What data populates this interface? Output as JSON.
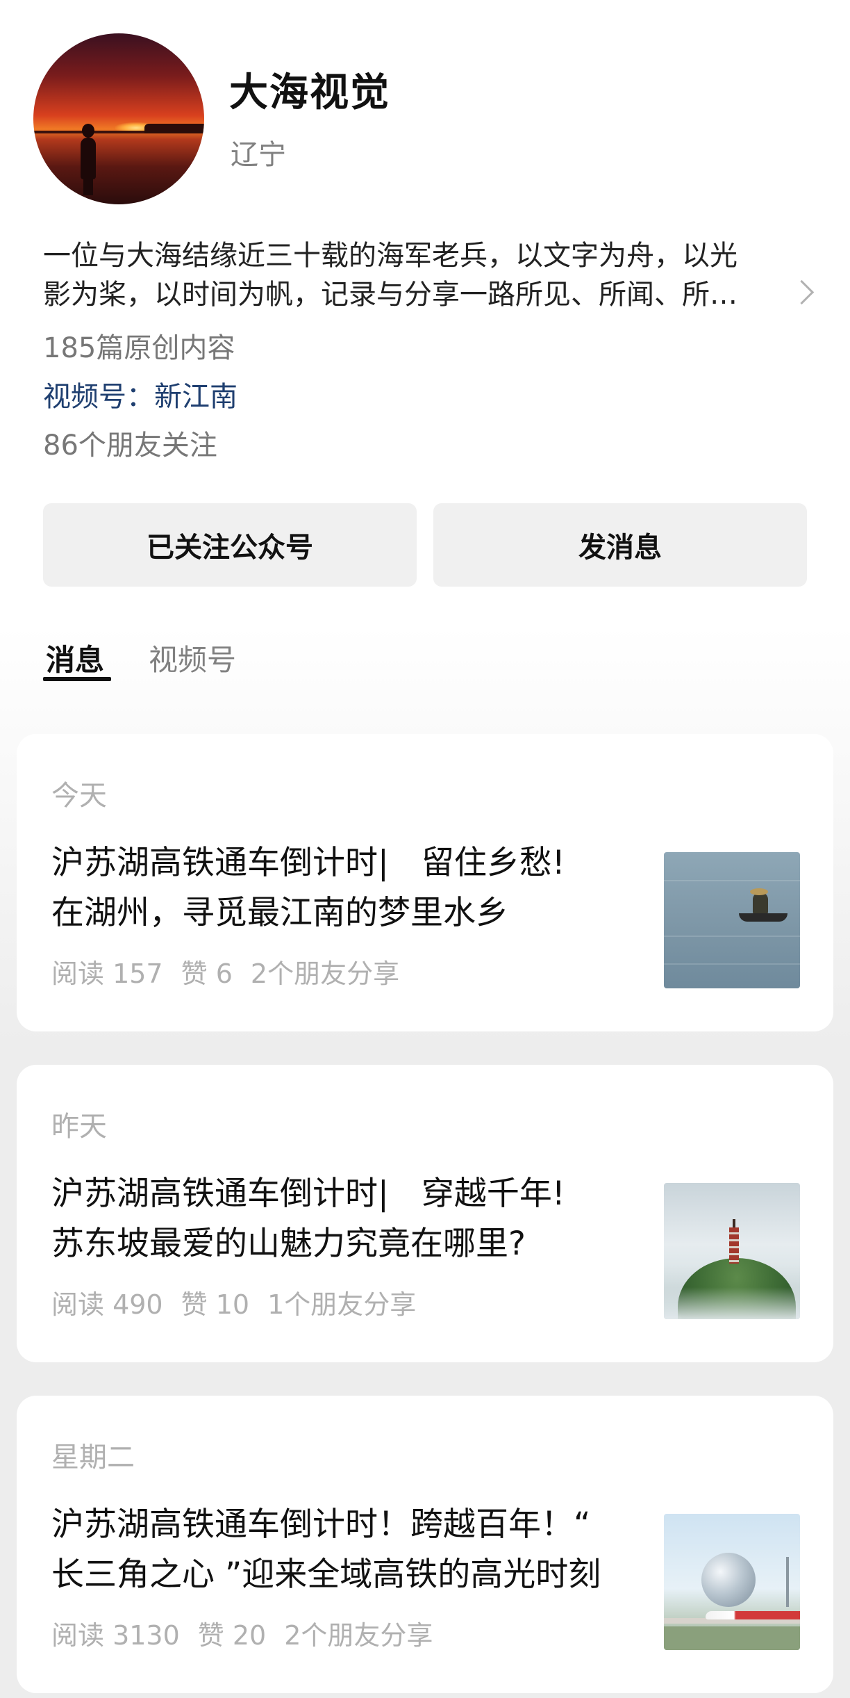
{
  "profile": {
    "name": "大海视觉",
    "region": "辽宁",
    "description_line1": "一位与大海结缘近三十载的海军老兵，以文字为舟，以光",
    "description_line2": "影为桨，以时间为帆，记录与分享一路所见、所闻、所…",
    "original_count": "185篇原创内容",
    "channel_label": "视频号：",
    "channel_name": "新江南",
    "friends_following": "86个朋友关注"
  },
  "actions": {
    "follow_label": "已关注公众号",
    "message_label": "发消息"
  },
  "tabs": [
    {
      "label": "消息",
      "active": true
    },
    {
      "label": "视频号",
      "active": false
    }
  ],
  "articles": [
    {
      "day": "今天",
      "title_line1": "沪苏湖高铁通车倒计时|　留住乡愁!",
      "title_line2": "在湖州，寻觅最江南的梦里水乡",
      "reads": "阅读 157",
      "likes": "赞 6",
      "shares": "2个朋友分享",
      "thumbnail": "lake-fisherman-image"
    },
    {
      "day": "昨天",
      "title_line1": "沪苏湖高铁通车倒计时|　穿越千年!",
      "title_line2": "苏东坡最爱的山魅力究竟在哪里?",
      "reads": "阅读 490",
      "likes": "赞 10",
      "shares": "1个朋友分享",
      "thumbnail": "misty-mountain-pagoda-image"
    },
    {
      "day": "星期二",
      "title_line1": "沪苏湖高铁通车倒计时！跨越百年！“",
      "title_line2": "长三角之心 ”迎来全域高铁的高光时刻",
      "reads": "阅读 3130",
      "likes": "赞 20",
      "shares": "2个朋友分享",
      "thumbnail": "sphere-building-train-image"
    }
  ],
  "colors": {
    "link_blue": "#1f3f70",
    "secondary_text": "#808080",
    "button_bg": "#f0f0f0",
    "page_bg": "#ededed"
  },
  "icons": {
    "description_more": "chevron-right-icon"
  }
}
